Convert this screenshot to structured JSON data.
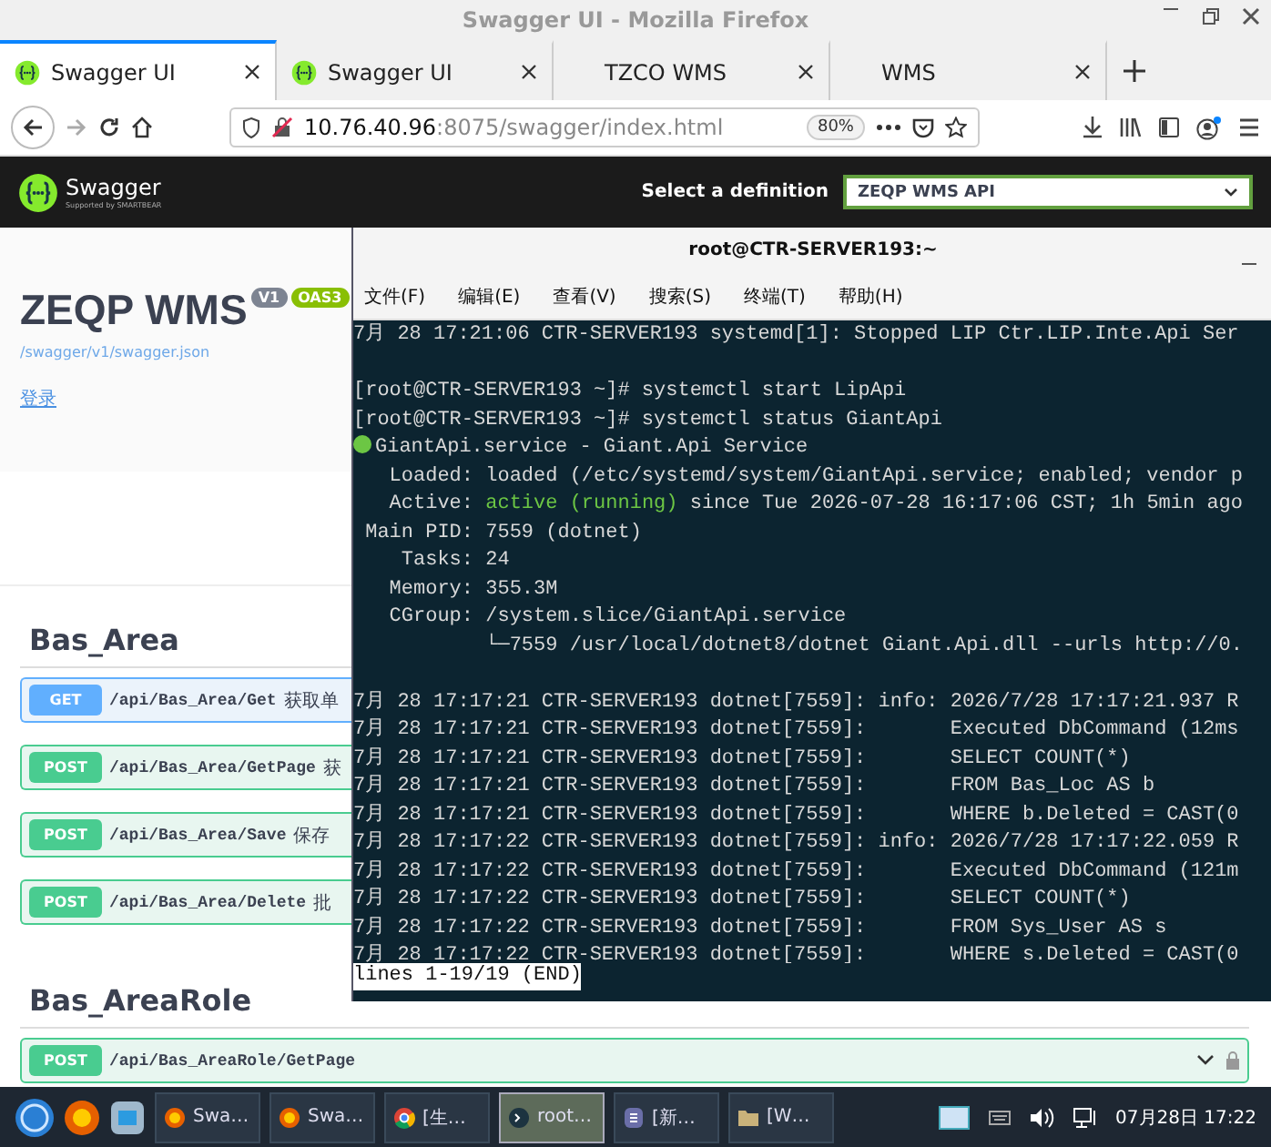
{
  "window": {
    "title": "Swagger UI - Mozilla Firefox"
  },
  "tabs": [
    {
      "label": "Swagger UI",
      "selected": true,
      "favicon": true
    },
    {
      "label": "Swagger UI",
      "selected": false,
      "favicon": true
    },
    {
      "label": "TZCO WMS",
      "selected": false,
      "favicon": false
    },
    {
      "label": "WMS",
      "selected": false,
      "favicon": false
    }
  ],
  "address_bar": {
    "host": "10.76.40.96",
    "path": ":8075/swagger/index.html",
    "zoom": "80%"
  },
  "swagger": {
    "logo": "Swagger",
    "logo_sub": "Supported by SMARTBEAR",
    "definition_label": "Select a definition",
    "definition": "ZEQP WMS API",
    "title": "ZEQP WMS",
    "badges": [
      {
        "label": "V1",
        "kind": "version"
      },
      {
        "label": "OAS3",
        "kind": "oas"
      }
    ],
    "spec_link": "/swagger/v1/swagger.json",
    "login_link": "登录",
    "sections": [
      {
        "name": "Bas_Area",
        "operations": [
          {
            "kind": "get",
            "method": "GET",
            "path": "/api/Bas_Area/Get",
            "summary": "获取单"
          },
          {
            "kind": "post",
            "method": "POST",
            "path": "/api/Bas_Area/GetPage",
            "summary": "获"
          },
          {
            "kind": "post",
            "method": "POST",
            "path": "/api/Bas_Area/Save",
            "summary": "保存"
          },
          {
            "kind": "post",
            "method": "POST",
            "path": "/api/Bas_Area/Delete",
            "summary": "批"
          }
        ]
      },
      {
        "name": "Bas_AreaRole",
        "operations": [
          {
            "kind": "post",
            "method": "POST",
            "path": "/api/Bas_AreaRole/GetPage"
          }
        ]
      }
    ]
  },
  "terminal": {
    "title": "root@CTR-SERVER193:~",
    "menu": [
      "文件(F)",
      "编辑(E)",
      "查看(V)",
      "搜索(S)",
      "终端(T)",
      "帮助(H)"
    ],
    "lines": [
      {
        "kind": "text",
        "text": "7月 28 17:21:06 CTR-SERVER193 systemd[1]: Stopped LIP Ctr.LIP.Inte.Api Ser"
      },
      {
        "kind": "blank"
      },
      {
        "kind": "text",
        "text": "[root@CTR-SERVER193 ~]# systemctl start LipApi"
      },
      {
        "kind": "text",
        "text": "[root@CTR-SERVER193 ~]# systemctl status GiantApi"
      },
      {
        "kind": "unit",
        "text": "GiantApi.service - Giant.Api Service"
      },
      {
        "kind": "text",
        "text": "   Loaded: loaded (/etc/systemd/system/GiantApi.service; enabled; vendor p"
      },
      {
        "kind": "active",
        "text": "   Active: ",
        "state": "active (running)",
        "rest": " since Tue 2026-07-28 16:17:06 CST; 1h 5min ago"
      },
      {
        "kind": "text",
        "text": " Main PID: 7559 (dotnet)"
      },
      {
        "kind": "text",
        "text": "    Tasks: 24"
      },
      {
        "kind": "text",
        "text": "   Memory: 355.3M"
      },
      {
        "kind": "text",
        "text": "   CGroup: /system.slice/GiantApi.service"
      },
      {
        "kind": "text",
        "text": "           └─7559 /usr/local/dotnet8/dotnet Giant.Api.dll --urls http://0."
      },
      {
        "kind": "blank"
      },
      {
        "kind": "text",
        "text": "7月 28 17:17:21 CTR-SERVER193 dotnet[7559]: info: 2026/7/28 17:17:21.937 R"
      },
      {
        "kind": "text",
        "text": "7月 28 17:17:21 CTR-SERVER193 dotnet[7559]:       Executed DbCommand (12ms"
      },
      {
        "kind": "text",
        "text": "7月 28 17:17:21 CTR-SERVER193 dotnet[7559]:       SELECT COUNT(*)"
      },
      {
        "kind": "text",
        "text": "7月 28 17:17:21 CTR-SERVER193 dotnet[7559]:       FROM Bas_Loc AS b"
      },
      {
        "kind": "text",
        "text": "7月 28 17:17:21 CTR-SERVER193 dotnet[7559]:       WHERE b.Deleted = CAST(0"
      },
      {
        "kind": "text",
        "text": "7月 28 17:17:22 CTR-SERVER193 dotnet[7559]: info: 2026/7/28 17:17:22.059 R"
      },
      {
        "kind": "text",
        "text": "7月 28 17:17:22 CTR-SERVER193 dotnet[7559]:       Executed DbCommand (121m"
      },
      {
        "kind": "text",
        "text": "7月 28 17:17:22 CTR-SERVER193 dotnet[7559]:       SELECT COUNT(*)"
      },
      {
        "kind": "text",
        "text": "7月 28 17:17:22 CTR-SERVER193 dotnet[7559]:       FROM Sys_User AS s"
      },
      {
        "kind": "text",
        "text": "7月 28 17:17:22 CTR-SERVER193 dotnet[7559]:       WHERE s.Deleted = CAST(0"
      }
    ],
    "status": "lines 1-19/19 (END)"
  },
  "taskbar": {
    "tasks": [
      {
        "kind": "firefox",
        "label": "Swa…",
        "selected": false
      },
      {
        "kind": "firefox",
        "label": "Swa…",
        "selected": false
      },
      {
        "kind": "chrome",
        "label": "[生…",
        "selected": false
      },
      {
        "kind": "terminal",
        "label": "root…",
        "selected": true
      },
      {
        "kind": "editor",
        "label": "[新…",
        "selected": false
      },
      {
        "kind": "folder",
        "label": "[W…",
        "selected": false
      }
    ],
    "clock": "07月28日 17:22"
  }
}
